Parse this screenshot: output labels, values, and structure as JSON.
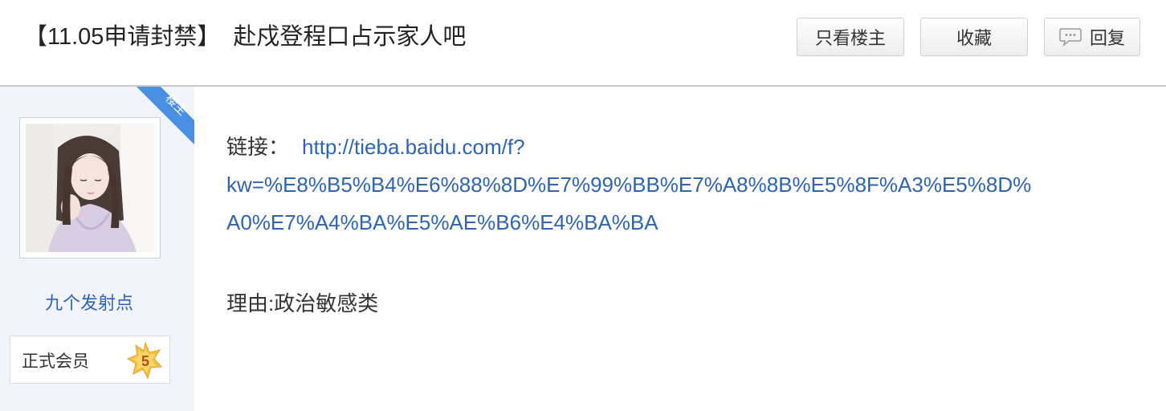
{
  "header": {
    "title_prefix": "【11.05申请封禁】",
    "title_main": "赴戍登程口占示家人吧",
    "buttons": {
      "only_lz": "只看楼主",
      "favorite": "收藏",
      "reply": "回复"
    }
  },
  "author": {
    "ribbon_label": "楼主",
    "username": "九个发射点",
    "member_label": "正式会员",
    "level": "5"
  },
  "post": {
    "link_label": "链接：",
    "link_url_line1": "http://tieba.baidu.com/f?",
    "link_url_line2": "kw=%E8%B5%B4%E6%88%8D%E7%99%BB%E7%A8%8B%E5%8F%A3%E5%8D%",
    "link_url_line3": "A0%E7%A4%BA%E5%AE%B6%E4%BA%BA",
    "reason": "理由:政治敏感类"
  },
  "colors": {
    "link": "#2d64b3",
    "ribbon": "#4a90e2",
    "panel_bg": "#f1f5fb",
    "badge": "#f3c044"
  },
  "icons": {
    "reply": "speech-bubble-icon",
    "level": "star-badge-icon"
  }
}
